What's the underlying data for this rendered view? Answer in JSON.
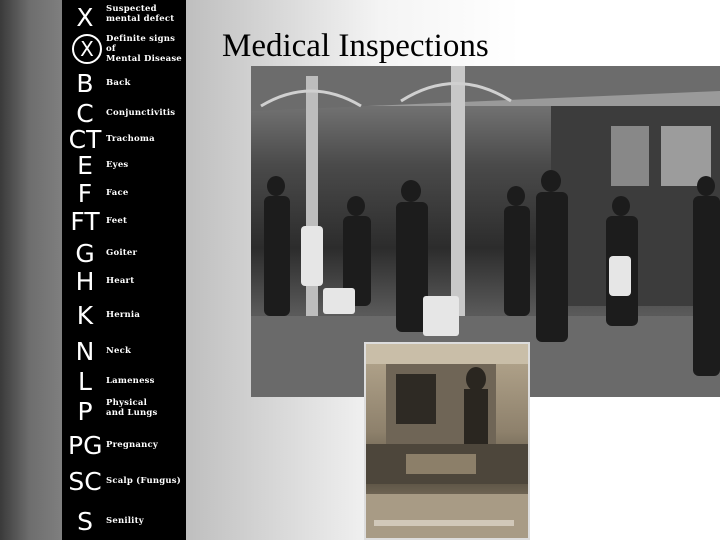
{
  "title": "Medical Inspections",
  "codes": [
    {
      "code": "X",
      "label": "Suspected\nmental defect",
      "circled": false
    },
    {
      "code": "X",
      "label": "Definite signs of\nMental Disease",
      "circled": true
    },
    {
      "code": "B",
      "label": "Back",
      "circled": false
    },
    {
      "code": "C",
      "label": "Conjunctivitis",
      "circled": false
    },
    {
      "code": "CT",
      "label": "Trachoma",
      "circled": false
    },
    {
      "code": "E",
      "label": "Eyes",
      "circled": false
    },
    {
      "code": "F",
      "label": "Face",
      "circled": false
    },
    {
      "code": "FT",
      "label": "Feet",
      "circled": false
    },
    {
      "code": "G",
      "label": "Goiter",
      "circled": false
    },
    {
      "code": "H",
      "label": "Heart",
      "circled": false
    },
    {
      "code": "K",
      "label": "Hernia",
      "circled": false
    },
    {
      "code": "N",
      "label": "Neck",
      "circled": false
    },
    {
      "code": "L",
      "label": "Lameness",
      "circled": false
    },
    {
      "code": "P",
      "label": "Physical\nand Lungs",
      "circled": false
    },
    {
      "code": "PG",
      "label": "Pregnancy",
      "circled": false
    },
    {
      "code": "SC",
      "label": "Scalp (Fungus)",
      "circled": false
    },
    {
      "code": "S",
      "label": "Senility",
      "circled": false
    }
  ]
}
